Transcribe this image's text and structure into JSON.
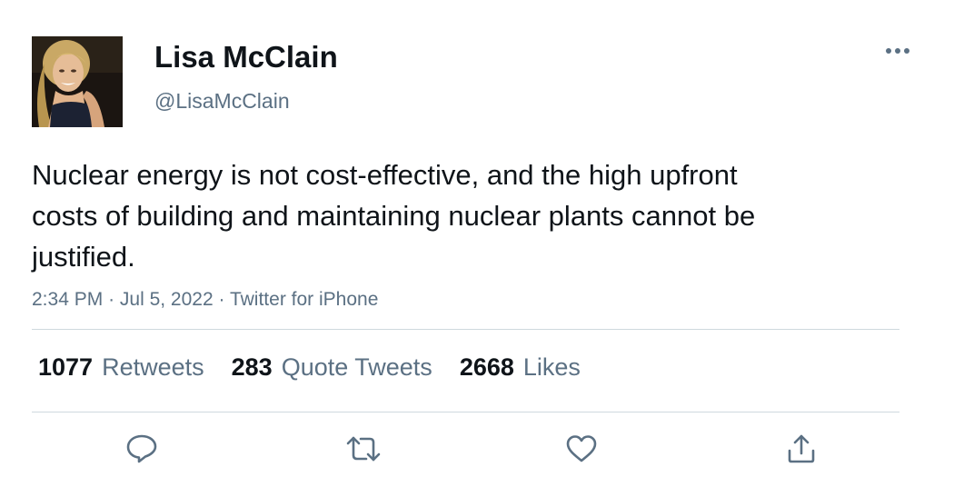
{
  "author": {
    "display_name": "Lisa McClain",
    "handle": "@LisaMcClain"
  },
  "tweet": {
    "text": "Nuclear energy is not cost-effective, and the high upfront costs of building and maintaining nuclear plants cannot be justified.",
    "time": "2:34 PM",
    "date": "Jul 5, 2022",
    "source": "Twitter for iPhone",
    "meta_separator": "·"
  },
  "stats": {
    "retweets_count": "1077",
    "retweets_label": "Retweets",
    "quotes_count": "283",
    "quotes_label": "Quote Tweets",
    "likes_count": "2668",
    "likes_label": "Likes"
  },
  "actions": [
    {
      "icon": "reply-icon"
    },
    {
      "icon": "retweet-icon"
    },
    {
      "icon": "like-heart-icon"
    },
    {
      "icon": "share-icon"
    }
  ],
  "colors": {
    "text_primary": "#0f1419",
    "text_secondary": "#5b7083",
    "divider": "#cfd9de"
  }
}
